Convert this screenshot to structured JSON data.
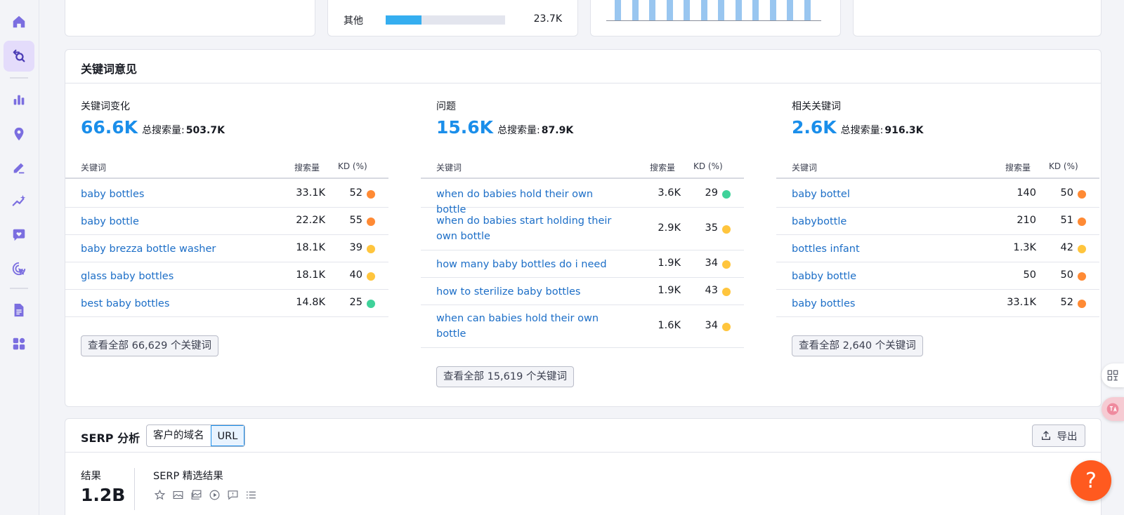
{
  "sidebar": {
    "items": [
      {
        "icon": "home-icon"
      },
      {
        "icon": "keyword-research-icon",
        "active": true
      },
      {
        "icon": "bar-chart-icon"
      },
      {
        "icon": "location-pin-icon"
      },
      {
        "icon": "content-edit-icon"
      },
      {
        "icon": "ai-sparkle-icon"
      },
      {
        "icon": "chat-heart-icon"
      },
      {
        "icon": "cursor-target-icon"
      },
      {
        "icon": "document-icon"
      },
      {
        "icon": "apps-grid-icon"
      }
    ]
  },
  "top_cards": {
    "other": {
      "label": "其他",
      "value": "23.7K",
      "fill_fraction": 0.3
    },
    "mini_chart": {
      "bar_count": 12
    }
  },
  "keyword_ideas": {
    "title": "关键词意见",
    "columns": [
      {
        "label": "关键词变化",
        "count": "66.6K",
        "total_label": "总搜索量:",
        "total": "503.7K",
        "headers": {
          "keyword": "关键词",
          "volume": "搜索量",
          "kd": "KD (%)"
        },
        "rows": [
          {
            "keyword": "baby bottles",
            "volume": "33.1K",
            "kd": "52",
            "level": "hard"
          },
          {
            "keyword": "baby bottle",
            "volume": "22.2K",
            "kd": "55",
            "level": "hard"
          },
          {
            "keyword": "baby brezza bottle washer",
            "volume": "18.1K",
            "kd": "39",
            "level": "medium"
          },
          {
            "keyword": "glass baby bottles",
            "volume": "18.1K",
            "kd": "40",
            "level": "medium"
          },
          {
            "keyword": "best baby bottles",
            "volume": "14.8K",
            "kd": "25",
            "level": "easy"
          }
        ],
        "view_all": "查看全部 66,629 个关键词"
      },
      {
        "label": "问题",
        "count": "15.6K",
        "total_label": "总搜索量:",
        "total": "87.9K",
        "headers": {
          "keyword": "关键词",
          "volume": "搜索量",
          "kd": "KD (%)"
        },
        "rows": [
          {
            "keyword": "when do babies hold their own bottle",
            "volume": "3.6K",
            "kd": "29",
            "level": "easy"
          },
          {
            "keyword": "when do babies start holding their own bottle",
            "volume": "2.9K",
            "kd": "35",
            "level": "medium"
          },
          {
            "keyword": "how many baby bottles do i need",
            "volume": "1.9K",
            "kd": "34",
            "level": "medium"
          },
          {
            "keyword": "how to sterilize baby bottles",
            "volume": "1.9K",
            "kd": "43",
            "level": "medium"
          },
          {
            "keyword": "when can babies hold their own bottle",
            "volume": "1.6K",
            "kd": "34",
            "level": "medium"
          }
        ],
        "view_all": "查看全部 15,619 个关键词"
      },
      {
        "label": "相关关键词",
        "count": "2.6K",
        "total_label": "总搜索量:",
        "total": "916.3K",
        "headers": {
          "keyword": "关键词",
          "volume": "搜索量",
          "kd": "KD (%)"
        },
        "rows": [
          {
            "keyword": "baby bottel",
            "volume": "140",
            "kd": "50",
            "level": "hard"
          },
          {
            "keyword": "babybottle",
            "volume": "210",
            "kd": "51",
            "level": "hard"
          },
          {
            "keyword": "bottles infant",
            "volume": "1.3K",
            "kd": "42",
            "level": "medium"
          },
          {
            "keyword": "babby bottle",
            "volume": "50",
            "kd": "50",
            "level": "hard"
          },
          {
            "keyword": "baby bottles",
            "volume": "33.1K",
            "kd": "52",
            "level": "hard"
          }
        ],
        "view_all": "查看全部 2,640 个关键词"
      }
    ]
  },
  "kd_colors": {
    "easy": "#3fd29a",
    "medium": "#ffc53d",
    "hard": "#ff8a34"
  },
  "serp": {
    "title": "SERP 分析",
    "tabs": [
      "客户的域名",
      "URL"
    ],
    "active_tab": "URL",
    "export_label": "导出",
    "results_label": "结果",
    "results_value": "1.2B",
    "features_label": "SERP 精选结果",
    "feature_icons": [
      "star-icon",
      "image-icon",
      "image-pack-icon",
      "video-icon",
      "review-icon",
      "list-icon"
    ]
  },
  "floating": {
    "help_label": "?"
  }
}
